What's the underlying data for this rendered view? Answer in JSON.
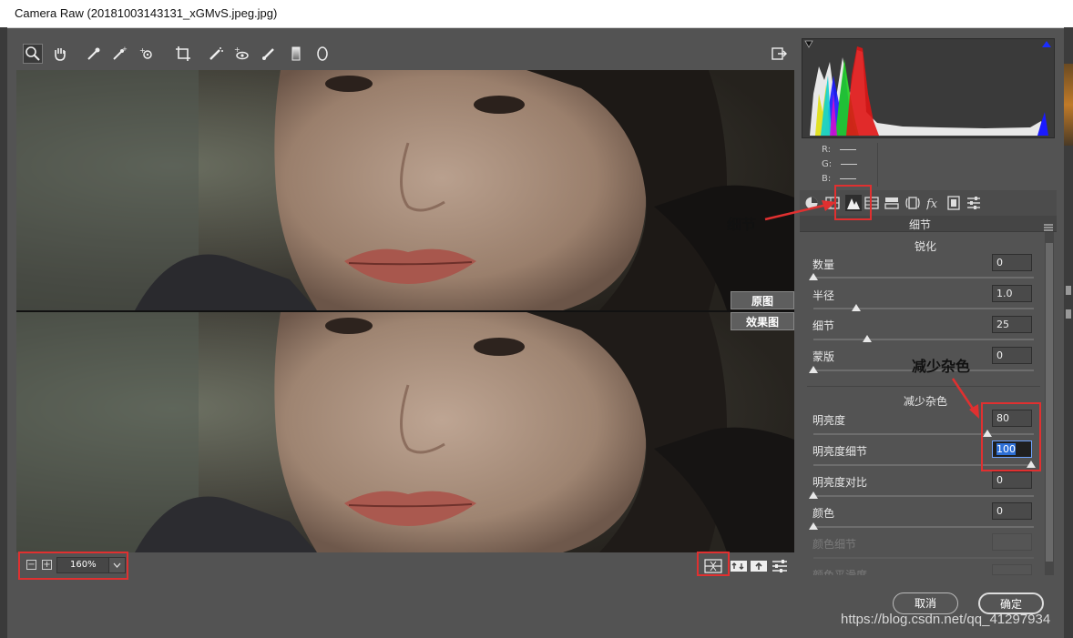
{
  "window": {
    "title": "Camera Raw (20181003143131_xGMvS.jpeg.jpg)"
  },
  "toolbar": {
    "tools": [
      "zoom-icon",
      "hand-icon",
      "white-balance-icon",
      "color-sampler-icon",
      "targeted-adjustment-icon",
      "crop-icon",
      "spot-removal-icon",
      "red-eye-icon",
      "adjustment-brush-icon",
      "graduated-filter-icon",
      "radial-filter-icon"
    ],
    "open_preferences": "export-icon"
  },
  "viewer": {
    "label_original": "原图",
    "label_effect": "效果图"
  },
  "zoom": {
    "value": "160%"
  },
  "histogram": {
    "r_label": "R:",
    "g_label": "G:",
    "b_label": "B:"
  },
  "panel": {
    "section_title": "细节",
    "sharpen": {
      "title": "锐化",
      "rows": [
        {
          "label": "数量",
          "value": "0",
          "pos": 0.0
        },
        {
          "label": "半径",
          "value": "1.0",
          "pos": 0.2
        },
        {
          "label": "细节",
          "value": "25",
          "pos": 0.25
        },
        {
          "label": "蒙版",
          "value": "0",
          "pos": 0.0
        }
      ]
    },
    "noise": {
      "title": "减少杂色",
      "rows": [
        {
          "label": "明亮度",
          "value": "80",
          "pos": 0.8
        },
        {
          "label": "明亮度细节",
          "value": "100",
          "pos": 1.0
        },
        {
          "label": "明亮度对比",
          "value": "0",
          "pos": 0.0
        },
        {
          "label": "颜色",
          "value": "0",
          "pos": 0.0
        },
        {
          "label": "颜色细节",
          "value": ""
        },
        {
          "label": "颜色平滑度",
          "value": ""
        }
      ]
    }
  },
  "annotations": {
    "detail_tab": "细节",
    "noise": "减少杂色"
  },
  "buttons": {
    "cancel": "取消",
    "ok": "确定"
  },
  "watermark": "https://blog.csdn.net/qq_41297934",
  "colors": {
    "annotation_red": "#e03030",
    "panel_bg": "#535353"
  }
}
